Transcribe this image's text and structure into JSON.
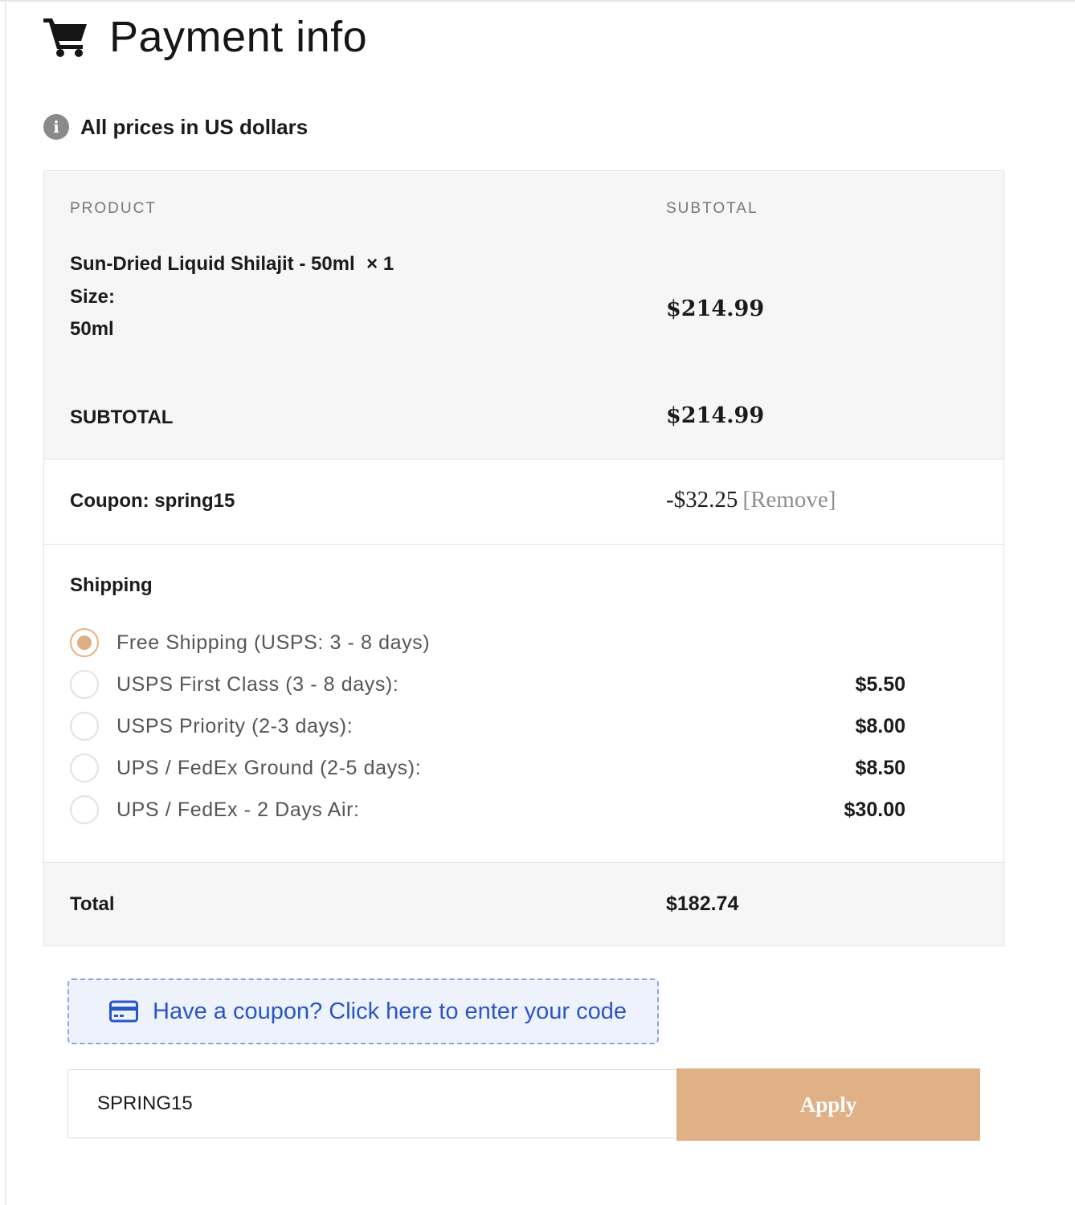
{
  "header": {
    "title": "Payment info",
    "icon": "cart-icon"
  },
  "notice": {
    "icon": "info-icon",
    "text": "All prices in US dollars"
  },
  "table": {
    "headers": {
      "product": "PRODUCT",
      "subtotal": "SUBTOTAL"
    },
    "item": {
      "name": "Sun-Dried Liquid Shilajit - 50ml",
      "qty": "× 1",
      "size_label": "Size:",
      "size_value": "50ml",
      "price": "$214.99"
    },
    "subtotal": {
      "label": "SUBTOTAL",
      "value": "$214.99"
    },
    "coupon": {
      "label": "Coupon: spring15",
      "amount": "-$32.25",
      "remove": "[Remove]"
    },
    "shipping": {
      "label": "Shipping",
      "options": [
        {
          "label": "Free Shipping (USPS: 3 - 8 days)",
          "price": "",
          "checked": true
        },
        {
          "label": "USPS First Class (3 - 8 days):",
          "price": "$5.50",
          "checked": false
        },
        {
          "label": "USPS Priority (2-3 days):",
          "price": "$8.00",
          "checked": false
        },
        {
          "label": "UPS / FedEx Ground (2-5 days):",
          "price": "$8.50",
          "checked": false
        },
        {
          "label": "UPS / FedEx - 2 Days Air:",
          "price": "$30.00",
          "checked": false
        }
      ]
    },
    "total": {
      "label": "Total",
      "value": "$182.74"
    }
  },
  "coupon_banner": {
    "icon": "credit-card-icon",
    "text": "Have a coupon? Click here to enter your code"
  },
  "coupon_form": {
    "value": "SPRING15",
    "apply_label": "Apply"
  },
  "colors": {
    "accent": "#e0b086",
    "link": "#2a55c6",
    "banner_bg": "#edf2fd",
    "banner_border": "#8aa4e6",
    "panel_bg": "#f6f6f6"
  }
}
